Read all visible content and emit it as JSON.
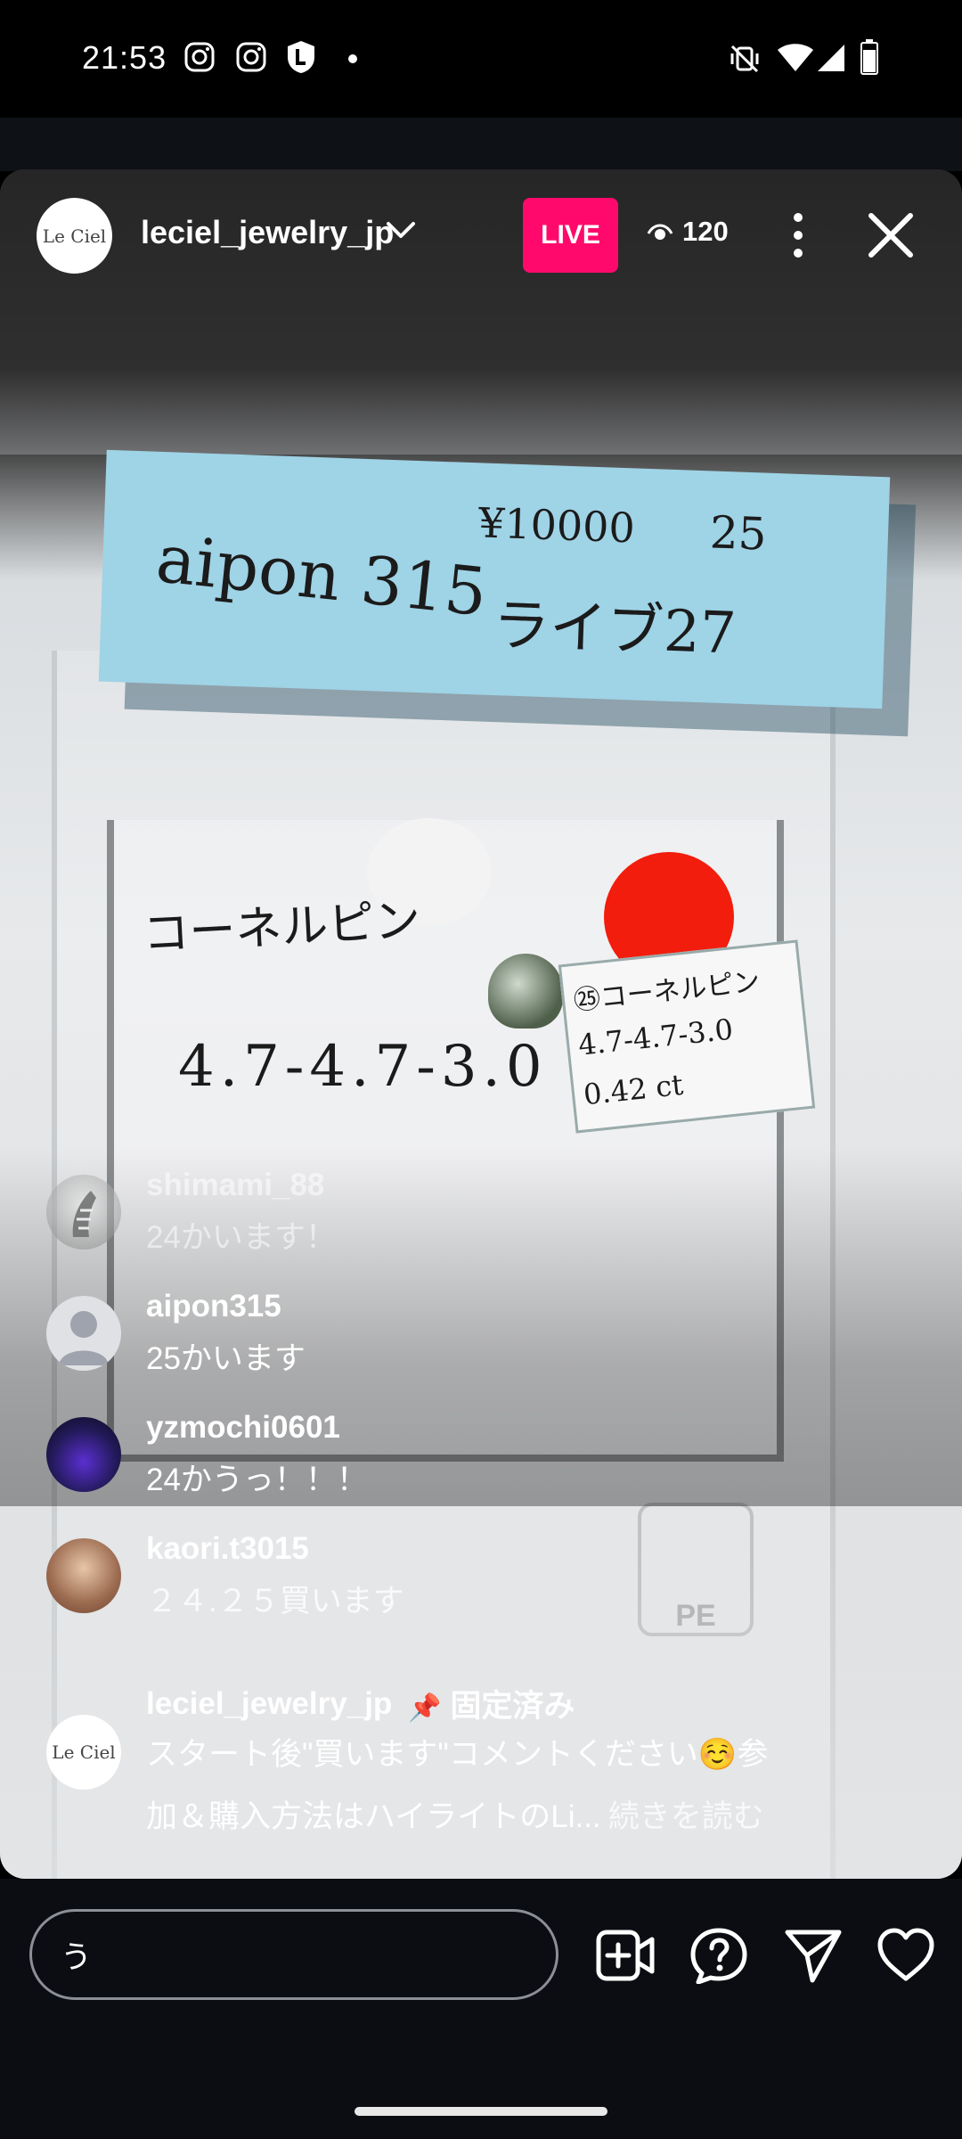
{
  "status_bar": {
    "time": "21:53",
    "left_icons": [
      "instagram-icon",
      "instagram-icon",
      "shield-l-icon",
      "dot-icon"
    ],
    "right_icons": [
      "vibrate-off-icon",
      "wifi-icon",
      "signal-icon",
      "battery-icon"
    ]
  },
  "header": {
    "avatar_text": "Le Ciel",
    "username": "leciel_jewelry_jp",
    "live_label": "LIVE",
    "viewer_count": "120"
  },
  "video_text": {
    "sticky_line1": "aipon 315",
    "sticky_price": "¥10000",
    "sticky_num": "25",
    "sticky_line2": "ライブ27",
    "card_line1": "コーネルピン",
    "card_line2": "4.7-4.7-3.0",
    "label_line1": "㉕コーネルピン",
    "label_line2": "4.7-4.7-3.0",
    "label_line3": "0.42 ct",
    "recycle": "PE"
  },
  "comments": [
    {
      "user": "shimami_88",
      "text": "24かいます！"
    },
    {
      "user": "aipon315",
      "text": "25かいます"
    },
    {
      "user": "yzmochi0601",
      "text": "24かうっ！！！"
    },
    {
      "user": "kaori.t3015",
      "text": "２４.２５買います"
    }
  ],
  "pinned": {
    "avatar_text": "Le Ciel",
    "user": "leciel_jewelry_jp",
    "pin_label": "固定済み",
    "line1": "スタート後\"買います\"コメントください☺️参",
    "line2": "加＆購入方法はハイライトのLi...",
    "read_more": "続きを読む"
  },
  "composer": {
    "input_value": "う"
  },
  "colors": {
    "live_badge": "#ff0a6c",
    "bottom_bar": "#0b0d12"
  }
}
